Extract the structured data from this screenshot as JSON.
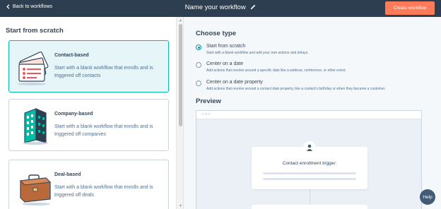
{
  "topbar": {
    "back_label": "Back to workflows",
    "workflow_name": "Name your workflow",
    "create_label": "Create workflow"
  },
  "left_panel": {
    "title": "Start from scratch",
    "cards": [
      {
        "title": "Contact-based",
        "description": "Start with a blank workflow that enrolls and is triggered off contacts",
        "selected": true
      },
      {
        "title": "Company-based",
        "description": "Start with a blank workflow that enrolls and is triggered off companies",
        "selected": false
      },
      {
        "title": "Deal-based",
        "description": "Start with a blank workflow that enrolls and is triggered off deals",
        "selected": false
      }
    ]
  },
  "choose_type": {
    "title": "Choose type",
    "options": [
      {
        "label": "Start from scratch",
        "description": "Start with a blank workflow and add your own actions and delays.",
        "selected": true
      },
      {
        "label": "Center on a date",
        "description": "Add actions that revolve around a specific date like a webinar, conference, or other event.",
        "selected": false
      },
      {
        "label": "Center on a date property",
        "description": "Add actions that revolve around a contact date property, like a contact's birthday or when they became a customer.",
        "selected": false
      }
    ]
  },
  "preview": {
    "title": "Preview",
    "trigger_label": "Contact enrollment trigger:"
  },
  "help_label": "Help",
  "colors": {
    "topbar": "#2d3e50",
    "accent_orange": "#ff7a59",
    "selected_card_bg": "#e5f5f8",
    "selected_card_border": "#00bda5",
    "radio_selected": "#0091ae"
  }
}
